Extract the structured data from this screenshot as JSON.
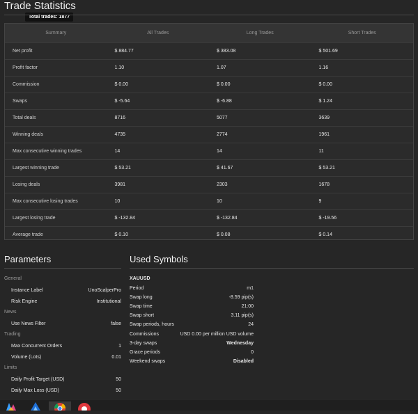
{
  "title": "Trade Statistics",
  "tooltip": "Total trades: 1877",
  "stats": {
    "headers": [
      "Summary",
      "All Trades",
      "Long Trades",
      "Short Trades"
    ],
    "rows": [
      [
        "Net profit",
        "$ 884.77",
        "$ 383.08",
        "$ 501.69"
      ],
      [
        "Profit factor",
        "1.10",
        "1.07",
        "1.16"
      ],
      [
        "Commission",
        "$ 0.00",
        "$ 0.00",
        "$ 0.00"
      ],
      [
        "Swaps",
        "$ -5.64",
        "$ -6.88",
        "$ 1.24"
      ],
      [
        "Total deals",
        "8716",
        "5077",
        "3639"
      ],
      [
        "Winning deals",
        "4735",
        "2774",
        "1961"
      ],
      [
        "Max consecutive winning trades",
        "14",
        "14",
        "11"
      ],
      [
        "Largest winning trade",
        "$ 53.21",
        "$ 41.67",
        "$ 53.21"
      ],
      [
        "Losing deals",
        "3981",
        "2303",
        "1678"
      ],
      [
        "Max consecutive losing trades",
        "10",
        "10",
        "9"
      ],
      [
        "Largest losing trade",
        "$ -132.84",
        "$ -132.84",
        "$ -19.56"
      ],
      [
        "Average trade",
        "$ 0.10",
        "$ 0.08",
        "$ 0.14"
      ]
    ]
  },
  "parameters": {
    "title": "Parameters",
    "groups": [
      {
        "name": "General",
        "items": [
          {
            "label": "Instance Label",
            "value": "UnoScalperPro"
          },
          {
            "label": "Risk Engine",
            "value": "Institutional"
          }
        ]
      },
      {
        "name": "News",
        "items": [
          {
            "label": "Use News Filter",
            "value": "false"
          }
        ]
      },
      {
        "name": "Trading",
        "items": [
          {
            "label": "Max Concurrent Orders",
            "value": "1"
          },
          {
            "label": "Volume (Lots)",
            "value": "0.01"
          }
        ]
      },
      {
        "name": "Limits",
        "items": [
          {
            "label": "Daily Profit Target (USD)",
            "value": "50"
          },
          {
            "label": "Daily Max Loss (USD)",
            "value": "50"
          }
        ]
      }
    ]
  },
  "symbols": {
    "title": "Used Symbols",
    "name": "XAUUSD",
    "rows": [
      {
        "label": "Period",
        "value": "m1"
      },
      {
        "label": "Swap long",
        "value": "-8.59 pip(s)"
      },
      {
        "label": "Swap time",
        "value": "21:00"
      },
      {
        "label": "Swap short",
        "value": "3.11 pip(s)"
      },
      {
        "label": "Swap periods, hours",
        "value": "24"
      },
      {
        "label": "Commissions",
        "value": "USD 0.00 per million USD volume"
      },
      {
        "label": "3-day swaps",
        "value": "Wednesday"
      },
      {
        "label": "Grace periods",
        "value": "0"
      },
      {
        "label": "Weekend swaps",
        "value": "Disabled"
      }
    ]
  },
  "taskbar": {
    "icons": [
      "copilot-icon",
      "edge-like-app-icon",
      "chrome-icon",
      "recorder-app-icon"
    ]
  }
}
